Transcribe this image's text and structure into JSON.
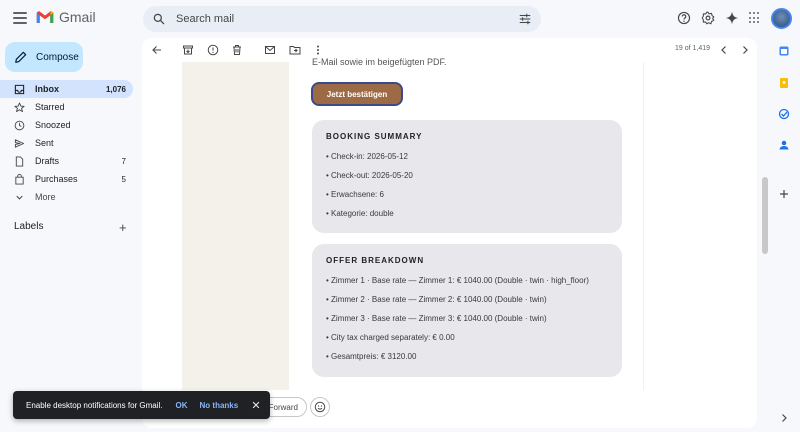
{
  "app": {
    "name": "Gmail"
  },
  "search": {
    "placeholder": "Search mail"
  },
  "sidebar": {
    "compose_label": "Compose",
    "items": [
      {
        "label": "Inbox",
        "count": "1,076",
        "icon": "inbox-icon",
        "active": true
      },
      {
        "label": "Starred",
        "count": "",
        "icon": "star-icon"
      },
      {
        "label": "Snoozed",
        "count": "",
        "icon": "clock-icon"
      },
      {
        "label": "Sent",
        "count": "",
        "icon": "send-icon"
      },
      {
        "label": "Drafts",
        "count": "7",
        "icon": "draft-icon"
      },
      {
        "label": "Purchases",
        "count": "5",
        "icon": "tag-icon"
      },
      {
        "label": "More",
        "count": "",
        "icon": "chevron-down-icon"
      }
    ],
    "labels_title": "Labels"
  },
  "toolbar": {
    "pager": "19 of 1,419"
  },
  "email": {
    "cut_text": "E-Mail sowie im beigefügten PDF.",
    "cta_label": "Jetzt bestätigen",
    "booking": {
      "title": "BOOKING SUMMARY",
      "lines": [
        "• Check-in: 2026-05-12",
        "• Check-out: 2026-05-20",
        "• Erwachsene: 6",
        "• Kategorie: double"
      ]
    },
    "offer": {
      "title": "OFFER BREAKDOWN",
      "lines": [
        "• Zimmer 1 · Base rate — Zimmer 1: € 1040.00 (Double · twin · high_floor)",
        "• Zimmer 2 · Base rate — Zimmer 2: € 1040.00 (Double · twin)",
        "• Zimmer 3 · Base rate — Zimmer 3: € 1040.00 (Double · twin)",
        "• City tax charged separately: € 0.00",
        "• Gesamtpreis: € 3120.00"
      ]
    }
  },
  "reply": {
    "forward_label": "Forward"
  },
  "toast": {
    "message": "Enable desktop notifications for Gmail.",
    "ok": "OK",
    "no_thanks": "No thanks"
  },
  "colors": {
    "accent": "#c2e7ff",
    "active_nav": "#d3e3fd",
    "cta": "#9c6b45"
  }
}
